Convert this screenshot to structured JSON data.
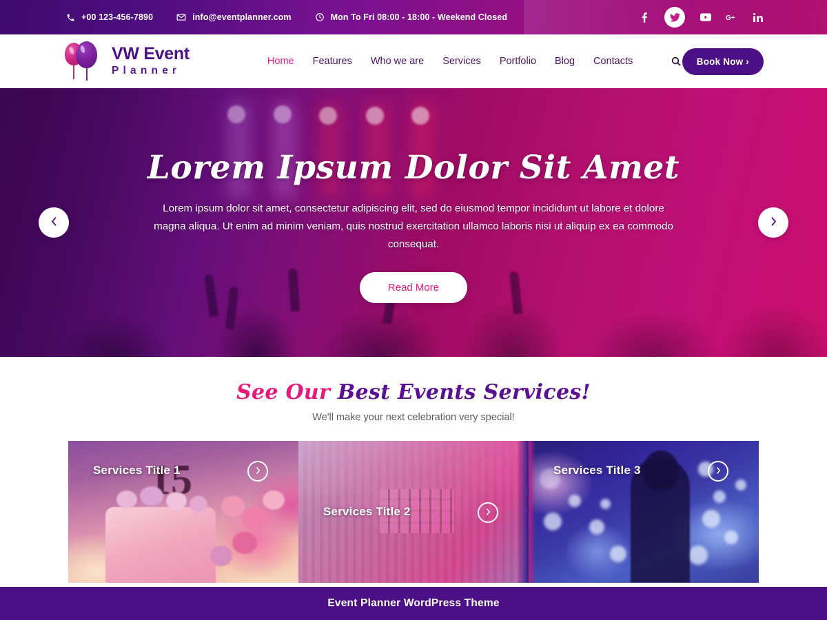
{
  "topbar": {
    "phone": "+00 123-456-7890",
    "email": "info@eventplanner.com",
    "hours": "Mon To Fri 08:00 - 18:00 - Weekend Closed",
    "phone_icon": "phone-icon",
    "email_icon": "envelope-icon",
    "hours_icon": "clock-icon",
    "social": [
      {
        "name": "facebook",
        "glyph": "f",
        "active": false
      },
      {
        "name": "twitter",
        "glyph": "",
        "active": true
      },
      {
        "name": "youtube",
        "glyph": "",
        "active": false
      },
      {
        "name": "google-plus",
        "glyph": "G+",
        "active": false
      },
      {
        "name": "linkedin",
        "glyph": "in",
        "active": false
      }
    ]
  },
  "header": {
    "logo_primary": "VW Event",
    "logo_secondary": "Planner",
    "nav": [
      {
        "label": "Home",
        "active": true
      },
      {
        "label": "Features",
        "active": false
      },
      {
        "label": "Who we are",
        "active": false
      },
      {
        "label": "Services",
        "active": false
      },
      {
        "label": "Portfolio",
        "active": false
      },
      {
        "label": "Blog",
        "active": false
      },
      {
        "label": "Contacts",
        "active": false
      }
    ],
    "search_icon": "search-icon",
    "book_label": "Book Now ›"
  },
  "hero": {
    "title": "Lorem Ipsum Dolor Sit Amet",
    "paragraph": "Lorem ipsum dolor sit amet, consectetur adipiscing elit, sed do eiusmod tempor incididunt ut labore et dolore magna aliqua.  Ut enim ad minim veniam, quis nostrud exercitation ullamco laboris nisi ut aliquip ex ea commodo consequat.",
    "button_label": "Read More",
    "prev_icon": "chevron-left-icon",
    "next_icon": "chevron-right-icon"
  },
  "services": {
    "title_pink": "See Our ",
    "title_purple": "Best Events Services!",
    "subtitle": "We'll make your next celebration very special!",
    "cards": [
      {
        "label": "Services Title 1",
        "arrow_icon": "chevron-right-icon"
      },
      {
        "label": "Services Title 2",
        "arrow_icon": "chevron-right-icon"
      },
      {
        "label": "Services Title 3",
        "arrow_icon": "chevron-right-icon"
      }
    ]
  },
  "footer": {
    "text": "Event Planner WordPress Theme"
  },
  "colors": {
    "deep_purple": "#4b0f86",
    "magenta": "#b01070",
    "accent_pink": "#e6187a",
    "nav_text": "#4a1560"
  }
}
